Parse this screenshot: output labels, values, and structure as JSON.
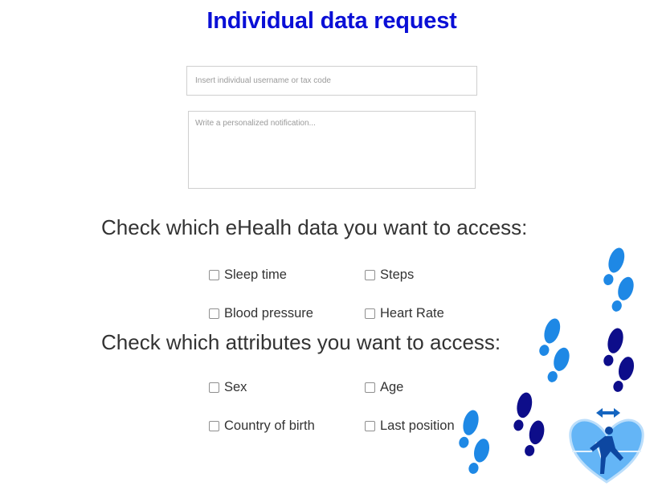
{
  "page": {
    "title": "Individual data request"
  },
  "form": {
    "username_placeholder": "Insert individual username or tax code",
    "username_value": "",
    "notification_placeholder": "Write a personalized notification...",
    "notification_value": ""
  },
  "ehealth_section": {
    "heading": "Check which eHealh data you want to access:",
    "options": [
      {
        "label": "Sleep time",
        "checked": false
      },
      {
        "label": "Steps",
        "checked": false
      },
      {
        "label": "Blood pressure",
        "checked": false
      },
      {
        "label": "Heart Rate",
        "checked": false
      }
    ]
  },
  "attributes_section": {
    "heading": "Check which attributes you want to access:",
    "options": [
      {
        "label": "Sex",
        "checked": false
      },
      {
        "label": "Age",
        "checked": false
      },
      {
        "label": "Country of birth",
        "checked": false
      },
      {
        "label": "Last position",
        "checked": false
      }
    ]
  },
  "decoration": {
    "icons": [
      "footprints-icon",
      "running-heart-icon"
    ],
    "colors": {
      "light_blue": "#1e88e5",
      "dark_navy": "#0d0d8a",
      "heart_fill": "#64b5f6",
      "arrow": "#1565c0"
    }
  }
}
